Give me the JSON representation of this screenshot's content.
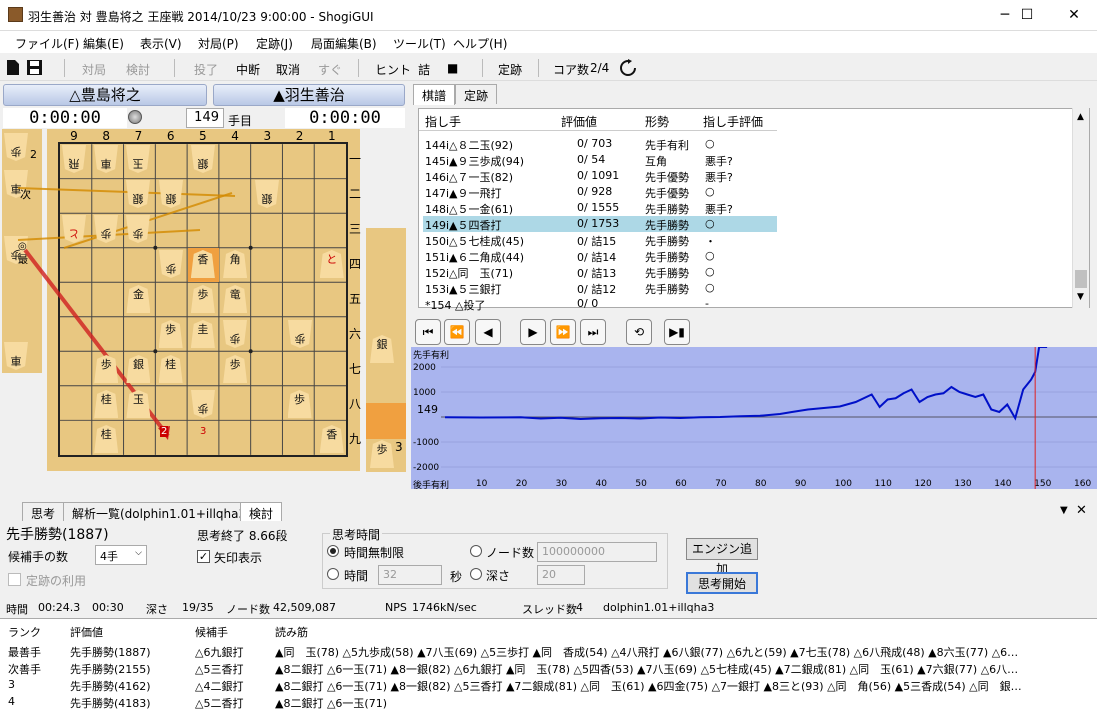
{
  "window": {
    "title": "羽生善治 対 豊島将之 王座戦 2014/10/23 9:00:00 - ShogiGUI",
    "minimize": "─",
    "maximize": "☐",
    "close": "✕"
  },
  "menu": [
    "ファイル(F)",
    "編集(E)",
    "表示(V)",
    "対局(P)",
    "定跡(J)",
    "局面編集(B)",
    "ツール(T)",
    "ヘルプ(H)"
  ],
  "toolbar": {
    "items": [
      "対局",
      "検討",
      "投了",
      "中断",
      "取消",
      "すぐ",
      "ヒント",
      "詰",
      "■",
      "定跡",
      "コア数",
      "2/4"
    ]
  },
  "players": {
    "gote": "△豊島将之",
    "sente": "▲羽生善治"
  },
  "clocks": {
    "gote": "0:00:00",
    "sente": "0:00:00"
  },
  "move_number": "149",
  "move_unit": "手目",
  "board": {
    "cols": [
      "9",
      "8",
      "7",
      "6",
      "5",
      "4",
      "3",
      "2",
      "1"
    ],
    "rows": [
      "一",
      "二",
      "三",
      "四",
      "五",
      "六",
      "七",
      "八",
      "九"
    ],
    "pieces": [
      {
        "c": 0,
        "r": 0,
        "t": "飛",
        "inv": true
      },
      {
        "c": 1,
        "r": 0,
        "t": "車",
        "inv": true
      },
      {
        "c": 2,
        "r": 0,
        "t": "玉",
        "inv": true
      },
      {
        "c": 4,
        "r": 0,
        "t": "銀",
        "inv": true
      },
      {
        "c": 2,
        "r": 1,
        "t": "銀",
        "inv": true
      },
      {
        "c": 3,
        "r": 1,
        "t": "銀",
        "inv": true
      },
      {
        "c": 6,
        "r": 1,
        "t": "銀",
        "inv": true
      },
      {
        "c": 0,
        "r": 2,
        "t": "と",
        "inv": true,
        "red": true
      },
      {
        "c": 1,
        "r": 2,
        "t": "歩",
        "inv": true
      },
      {
        "c": 2,
        "r": 2,
        "t": "歩",
        "inv": true
      },
      {
        "c": 3,
        "r": 3,
        "t": "歩",
        "inv": true
      },
      {
        "c": 4,
        "r": 3,
        "t": "香",
        "inv": false,
        "hl": true
      },
      {
        "c": 5,
        "r": 3,
        "t": "角",
        "inv": false
      },
      {
        "c": 8,
        "r": 3,
        "t": "と",
        "inv": false,
        "red": true
      },
      {
        "c": 2,
        "r": 4,
        "t": "金",
        "inv": false
      },
      {
        "c": 4,
        "r": 4,
        "t": "歩",
        "inv": false
      },
      {
        "c": 5,
        "r": 4,
        "t": "竜",
        "inv": false
      },
      {
        "c": 3,
        "r": 5,
        "t": "歩",
        "inv": false
      },
      {
        "c": 4,
        "r": 5,
        "t": "圭",
        "inv": false
      },
      {
        "c": 5,
        "r": 5,
        "t": "歩",
        "inv": true
      },
      {
        "c": 7,
        "r": 5,
        "t": "歩",
        "inv": true
      },
      {
        "c": 1,
        "r": 6,
        "t": "歩",
        "inv": false
      },
      {
        "c": 2,
        "r": 6,
        "t": "銀",
        "inv": false
      },
      {
        "c": 3,
        "r": 6,
        "t": "桂",
        "inv": false
      },
      {
        "c": 5,
        "r": 6,
        "t": "歩",
        "inv": false
      },
      {
        "c": 1,
        "r": 7,
        "t": "桂",
        "inv": false
      },
      {
        "c": 2,
        "r": 7,
        "t": "玉",
        "inv": false
      },
      {
        "c": 4,
        "r": 7,
        "t": "歩",
        "inv": true
      },
      {
        "c": 7,
        "r": 7,
        "t": "歩",
        "inv": false
      },
      {
        "c": 1,
        "r": 8,
        "t": "桂",
        "inv": false
      },
      {
        "c": 8,
        "r": 8,
        "t": "香",
        "inv": false
      }
    ],
    "arrow_labels": [
      "2",
      "3"
    ]
  },
  "gote_hand": [
    {
      "t": "歩",
      "count": "2"
    },
    {
      "t": "車",
      "count": "次"
    },
    {
      "t": "歩",
      "count": "◎最"
    },
    {
      "t": "車",
      "count": ""
    }
  ],
  "sente_hand": [
    {
      "t": "銀",
      "count": ""
    },
    {
      "t": "歩",
      "count": "3"
    }
  ],
  "right_tabs": [
    "棋譜",
    "定跡"
  ],
  "kifu": {
    "headers": [
      "指し手",
      "評価値",
      "形勢",
      "指し手評価"
    ],
    "rows": [
      {
        "m": "144i△８二玉(92)",
        "v": "0/ 703",
        "s": "先手有利",
        "e": "○"
      },
      {
        "m": "145i▲９三歩成(94)",
        "v": "0/ 54",
        "s": "互角",
        "e": "悪手?"
      },
      {
        "m": "146i△７一玉(82)",
        "v": "0/ 1091",
        "s": "先手優勢",
        "e": "悪手?"
      },
      {
        "m": "147i▲９一飛打",
        "v": "0/ 928",
        "s": "先手優勢",
        "e": "○"
      },
      {
        "m": "148i△５一金(61)",
        "v": "0/ 1555",
        "s": "先手勝勢",
        "e": "悪手?"
      },
      {
        "m": "149i▲５四香打",
        "v": "0/ 1753",
        "s": "先手勝勢",
        "e": "○",
        "sel": true
      },
      {
        "m": "150i△５七桂成(45)",
        "v": "0/ 詰15",
        "s": "先手勝勢",
        "e": "・"
      },
      {
        "m": "151i▲６二角成(44)",
        "v": "0/ 詰14",
        "s": "先手勝勢",
        "e": "○"
      },
      {
        "m": "152i△同　玉(71)",
        "v": "0/ 詰13",
        "s": "先手勝勢",
        "e": "○"
      },
      {
        "m": "153i▲５三銀打",
        "v": "0/ 詰12",
        "s": "先手勝勢",
        "e": "○"
      },
      {
        "m": "*154 △投了",
        "v": "0/ 0",
        "s": "",
        "e": "-"
      }
    ]
  },
  "nav": [
    "⏮",
    "⏪",
    "◀",
    "▶",
    "⏩",
    "⏭",
    "⟲",
    "▶▮"
  ],
  "graph": {
    "ylabel_top": "先手有利",
    "ylabel_bottom": "後手有利",
    "yticks": [
      "2000",
      "1000",
      "-1000",
      "-2000"
    ],
    "xticks": [
      "10",
      "20",
      "30",
      "40",
      "50",
      "60",
      "70",
      "80",
      "90",
      "100",
      "110",
      "120",
      "130",
      "140",
      "150",
      "160"
    ],
    "current": "149",
    "eval_points": [
      [
        1,
        -10
      ],
      [
        10,
        -20
      ],
      [
        20,
        -10
      ],
      [
        25,
        -60
      ],
      [
        30,
        -30
      ],
      [
        35,
        -80
      ],
      [
        40,
        -50
      ],
      [
        45,
        -40
      ],
      [
        50,
        -60
      ],
      [
        55,
        -20
      ],
      [
        60,
        -40
      ],
      [
        65,
        -10
      ],
      [
        70,
        0
      ],
      [
        75,
        30
      ],
      [
        80,
        50
      ],
      [
        85,
        120
      ],
      [
        88,
        200
      ],
      [
        92,
        300
      ],
      [
        96,
        360
      ],
      [
        100,
        420
      ],
      [
        104,
        600
      ],
      [
        108,
        900
      ],
      [
        110,
        400
      ],
      [
        112,
        700
      ],
      [
        114,
        750
      ],
      [
        116,
        950
      ],
      [
        118,
        1100
      ],
      [
        120,
        600
      ],
      [
        122,
        800
      ],
      [
        124,
        900
      ],
      [
        126,
        950
      ],
      [
        128,
        1200
      ],
      [
        130,
        1000
      ],
      [
        132,
        900
      ],
      [
        134,
        800
      ],
      [
        136,
        900
      ],
      [
        138,
        300
      ],
      [
        140,
        200
      ],
      [
        142,
        500
      ],
      [
        144,
        -50
      ],
      [
        146,
        1100
      ],
      [
        148,
        1500
      ],
      [
        149,
        1800
      ],
      [
        150,
        2800
      ],
      [
        152,
        3200
      ]
    ]
  },
  "bottom_tabs": [
    "思考",
    "解析一覧(dolphin1.01+illqha3)",
    "検討"
  ],
  "analysis": {
    "state": "先手勝勢(1887)",
    "candidates_label": "候補手の数",
    "candidates_value": "4手",
    "joseki_label": "定跡の利用",
    "done_label": "思考終了 8.66段",
    "arrow_label": "矢印表示",
    "think_time_label": "思考時間",
    "unlimited_label": "時間無制限",
    "time_label": "時間",
    "time_value": "32",
    "sec_label": "秒",
    "nodes_label": "ノード数",
    "nodes_value": "100000000",
    "depth_label": "深さ",
    "depth_value": "20",
    "add_engine": "エンジン追加",
    "start": "思考開始"
  },
  "status": {
    "time_label": "時間",
    "time1": "00:24.3",
    "time2": "00:30",
    "depth_label": "深さ",
    "depth": "19/35",
    "nodes_label": "ノード数",
    "nodes": "42,509,087",
    "nps_label": "NPS",
    "nps": "1746kN/sec",
    "threads_label": "スレッド数",
    "threads": "4",
    "engine": "dolphin1.01+illqha3"
  },
  "pv": {
    "headers": [
      "ランク",
      "評価値",
      "候補手",
      "読み筋"
    ],
    "rows": [
      {
        "rank": "最善手",
        "val": "先手勝勢(1887)",
        "move": "△6九銀打",
        "line": "▲同　玉(78) △5九歩成(58) ▲7八玉(69) △5三歩打 ▲同　香成(54) △4八飛打 ▲6八銀(77) △6九と(59) ▲7七玉(78) △6八飛成(48) ▲8六玉(77) △6…"
      },
      {
        "rank": "次善手",
        "val": "先手勝勢(2155)",
        "move": "△5三香打",
        "line": "▲8二銀打 △6一玉(71) ▲8一銀(82) △6九銀打 ▲同　玉(78) △5四香(53) ▲7八玉(69) △5七桂成(45) ▲7二銀成(81) △同　玉(61) ▲7六銀(77) △6八…"
      },
      {
        "rank": "3",
        "val": "先手勝勢(4162)",
        "move": "△4二銀打",
        "line": "▲8二銀打 △6一玉(71) ▲8一銀(82) △5三香打 ▲7二銀成(81) △同　玉(61) ▲6四金(75) △7一銀打 ▲8三と(93) △同　角(56) ▲5三香成(54) △同　銀…"
      },
      {
        "rank": "4",
        "val": "先手勝勢(4183)",
        "move": "△5二香打",
        "line": "▲8二銀打 △6一玉(71)"
      }
    ]
  }
}
